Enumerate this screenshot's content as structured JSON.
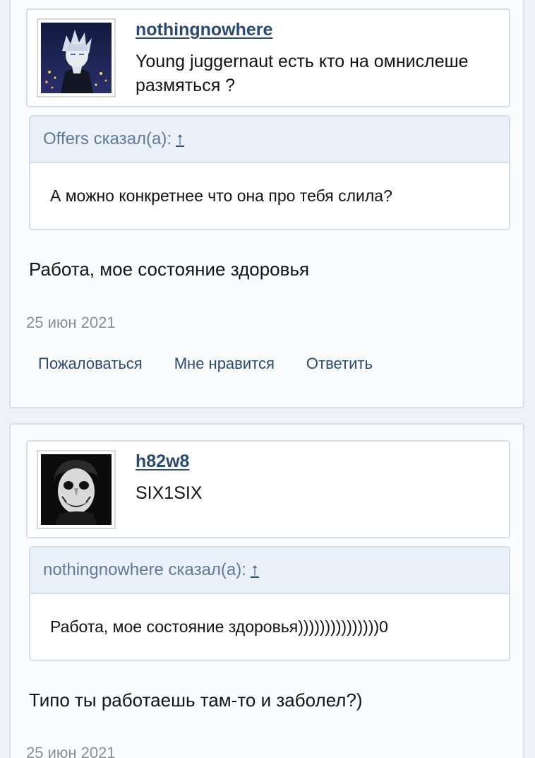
{
  "posts": [
    {
      "author": {
        "name": "nothingnowhere",
        "title": "Young juggernaut есть кто на омнислеше размяться ?",
        "avatar": "anime-character-avatar"
      },
      "quote": {
        "header": "Offers сказал(а):",
        "arrow": "↑",
        "text": "А можно конкретнее что она про тебя слила?"
      },
      "text": "Работа, мое состояние здоровья",
      "date": "25 июн 2021",
      "actions": {
        "report": "Пожаловаться",
        "like": "Мне нравится",
        "reply": "Ответить"
      }
    },
    {
      "author": {
        "name": "h82w8",
        "title": "SIX1SIX",
        "avatar": "joker-avatar"
      },
      "quote": {
        "header": "nothingnowhere сказал(а):",
        "arrow": "↑",
        "text": "Работа, мое состояние здоровья)))))))))))))))0"
      },
      "text": "Типо ты работаешь там-то и заболел?)",
      "date": "25 июн 2021"
    }
  ],
  "colors": {
    "link": "#2b4a71",
    "quote_header_bg": "#eaf0f7",
    "quote_header_text": "#60799a",
    "border": "#d3deea",
    "muted": "#8b8f94"
  }
}
